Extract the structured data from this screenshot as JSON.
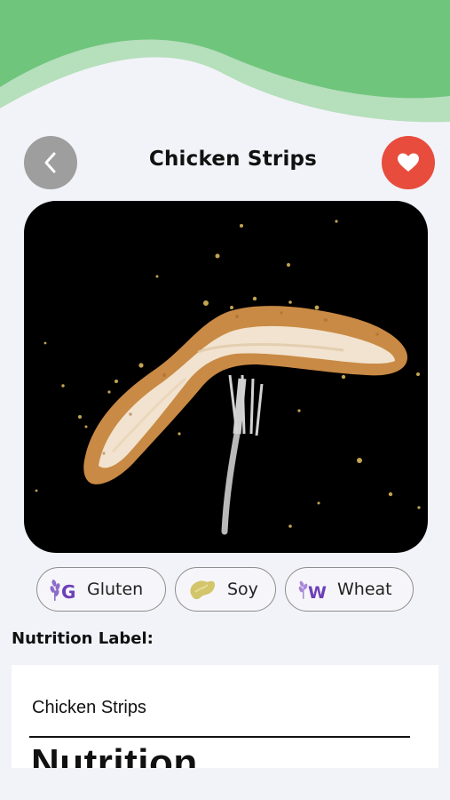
{
  "header": {
    "title": "Chicken Strips",
    "back_icon": "chevron-left-icon",
    "favorite_icon": "heart-icon",
    "colors": {
      "header_green": "#6fc57c",
      "header_light_green": "#b6dfbc",
      "back_button": "#9e9e9e",
      "favorite_button": "#e74c3c"
    }
  },
  "hero_image": {
    "subject": "chicken-strip-on-fork"
  },
  "allergens": [
    {
      "label": "Gluten",
      "icon": "gluten-icon"
    },
    {
      "label": "Soy",
      "icon": "soybean-icon"
    },
    {
      "label": "Wheat",
      "icon": "wheat-icon"
    }
  ],
  "nutrition": {
    "section_title": "Nutrition Label:",
    "product_name": "Chicken Strips",
    "heading": "Nutrition"
  }
}
